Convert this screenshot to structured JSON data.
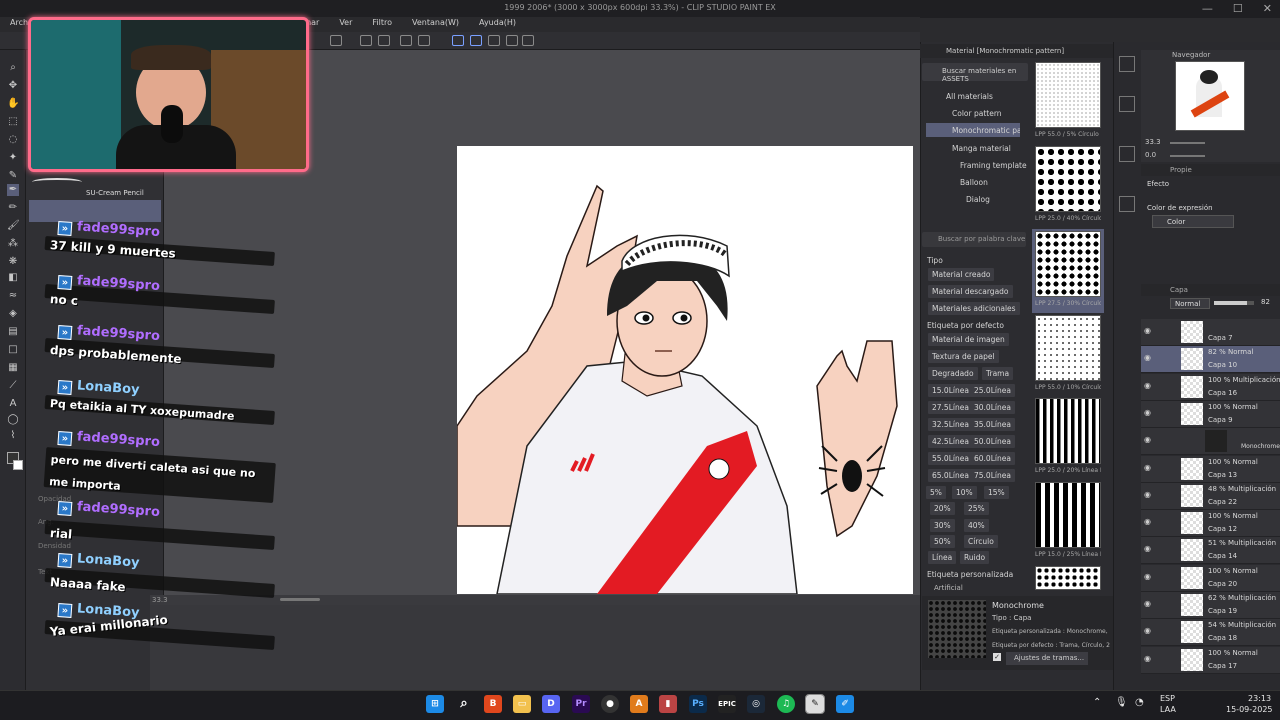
{
  "window": {
    "title": "1999 2006* (3000 x 3000px 600dpi 33.3%) - CLIP STUDIO PAINT EX"
  },
  "menu": {
    "items": [
      "Arch",
      "nar",
      "Ver",
      "Filtro",
      "Ventana(W)",
      "Ayuda(H)"
    ]
  },
  "subtool": {
    "brush_name": "SU-Cream Pencil",
    "faded_labels": [
      "Opacidad",
      "Ang.",
      "Densidad",
      "Text"
    ]
  },
  "chat": {
    "messages": [
      {
        "user": "fade99spro",
        "text": "37 kill y 9 muertes"
      },
      {
        "user": "fade99spro",
        "text": "no c"
      },
      {
        "user": "fade99spro",
        "text": "dps probablemente"
      },
      {
        "user": "LonaBoy",
        "text": "Pq etaikia al TY xoxepumadre"
      },
      {
        "user": "fade99spro",
        "text": "pero me diverti caleta asi que no me importa"
      },
      {
        "user": "fade99spro",
        "text": "rial"
      },
      {
        "user": "LonaBoy",
        "text": "Naaaa fake"
      },
      {
        "user": "LonaBoy",
        "text": "Ya erai millonario"
      }
    ]
  },
  "canvas": {
    "zoom_label": "33.3"
  },
  "material_panel": {
    "title": "Material [Monochromatic pattern]",
    "search_assets": "Buscar materiales en ASSETS",
    "tree": [
      "All materials",
      "Color pattern",
      "Monochromatic patte",
      "Manga material",
      "Framing template",
      "Balloon",
      "Dialog"
    ],
    "search_keyword": "Buscar por palabra clave",
    "tipo_label": "Tipo",
    "tipo_buttons": [
      "Material creado",
      "Material descargado",
      "Materiales adicionales"
    ],
    "default_tag_label": "Etiqueta por defecto",
    "default_tag_buttons": [
      "Material de imagen",
      "Textura de papel"
    ],
    "small_tags": [
      "Degradado",
      "Trama",
      "15.0Línea",
      "25.0Línea",
      "27.5Línea",
      "30.0Línea",
      "32.5Línea",
      "35.0Línea",
      "42.5Línea",
      "50.0Línea",
      "55.0Línea",
      "60.0Línea",
      "65.0Línea",
      "75.0Línea",
      "5%",
      "10%",
      "15%",
      "20%",
      "25%",
      "30%",
      "40%",
      "50%",
      "Círculo",
      "Línea",
      "Ruido"
    ],
    "custom_tag_label": "Etiqueta personalizada",
    "custom_tag_first": "Artificial",
    "swatch_labels": [
      "LPP 55.0 / 5% Círculo Mo",
      "LPP 25.0 / 40% Círculo Mo",
      "LPP 27.5 / 30% Círculo M",
      "LPP 55.0 / 10% Círculo Mo",
      "LPP 25.0 / 20% Línea Mo",
      "LPP 15.0 / 25% Línea Mo"
    ],
    "detail_name": "Monochrome",
    "detail_type": "Tipo : Capa",
    "detail_custom": "Etiqueta personalizada : Monochrome, Monochro",
    "detail_default": "Etiqueta por defecto : Trama, Círculo, 27.5Línea",
    "detail_button": "Ajustes de tramas..."
  },
  "navigator": {
    "title": "Navegador",
    "zoom": "33.3",
    "angle": "0.0"
  },
  "properties": {
    "title": "Propie",
    "effect_label": "Efecto",
    "color_label": "Color de expresión",
    "color_value": "Color"
  },
  "layers": {
    "title": "Capa",
    "blend_mode": "Normal",
    "opacity": "82",
    "rows": [
      {
        "mode": "",
        "name": "Capa 7"
      },
      {
        "mode": "82 % Normal",
        "name": "Capa 10"
      },
      {
        "mode": "100 % Multiplicación",
        "name": "Capa 16"
      },
      {
        "mode": "100 % Normal",
        "name": "Capa 9"
      },
      {
        "mode": "",
        "name": "Monochrome"
      },
      {
        "mode": "100 % Normal",
        "name": "Capa 13"
      },
      {
        "mode": "48 % Multiplicación",
        "name": "Capa 22"
      },
      {
        "mode": "100 % Normal",
        "name": "Capa 12"
      },
      {
        "mode": "51 % Multiplicación",
        "name": "Capa 14"
      },
      {
        "mode": "100 % Normal",
        "name": "Capa 20"
      },
      {
        "mode": "62 % Multiplicación",
        "name": "Capa 19"
      },
      {
        "mode": "54 % Multiplicación",
        "name": "Capa 18"
      },
      {
        "mode": "100 % Normal",
        "name": "Capa 17"
      }
    ]
  },
  "taskbar": {
    "lang": "ESP",
    "lang2": "LAA",
    "time": "23:13",
    "date": "15-09-2025",
    "apps": [
      "windows",
      "search",
      "brave",
      "files",
      "discord",
      "premiere",
      "obs",
      "artrage",
      "nvidia",
      "photoshop",
      "epic",
      "steam",
      "spotify",
      "clip-studio",
      "paint"
    ]
  },
  "colors": {
    "accent": "#5a5f7a",
    "webcam_border": "#ff6b8a",
    "chat_name_a": "#b06dff",
    "chat_name_b": "#8fd0ff"
  }
}
